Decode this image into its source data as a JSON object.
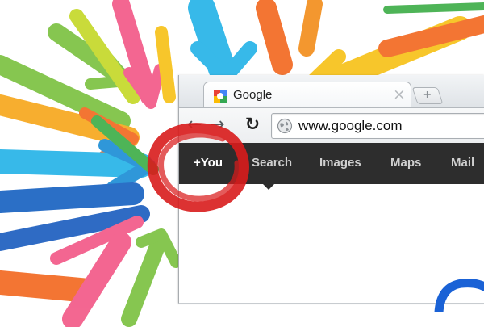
{
  "tab": {
    "title": "Google",
    "close_glyph": "×",
    "favicon": "google-favicon-icon"
  },
  "newtab": {
    "glyph": "+"
  },
  "toolbar": {
    "back_glyph": "←",
    "forward_glyph": "→",
    "reload_glyph": "↻",
    "url": "www.google.com"
  },
  "gbar": {
    "items": [
      {
        "label": "+You"
      },
      {
        "label": "Search"
      },
      {
        "label": "Images"
      },
      {
        "label": "Maps"
      },
      {
        "label": "Mail"
      }
    ]
  },
  "colors": {
    "gbar_bg": "#2d2d2d",
    "marker_red": "#d91c1c",
    "logo_blue": "#1a62d6"
  }
}
